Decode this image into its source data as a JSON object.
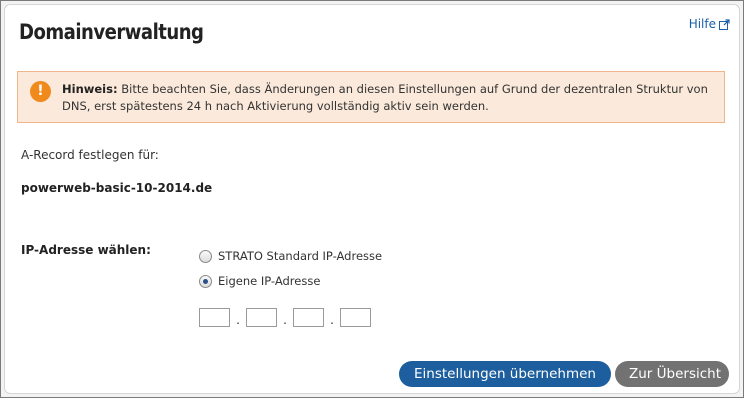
{
  "header": {
    "title": "Domainverwaltung",
    "help_label": "Hilfe"
  },
  "notice": {
    "prefix": "Hinweis:",
    "text": "Bitte beachten Sie, dass Änderungen an diesen Einstellungen auf Grund der dezentralen Struktur von DNS, erst spätestens 24 h nach Aktivierung vollständig aktiv sein werden.",
    "icon_symbol": "!",
    "accent_color": "#f08a1c",
    "background_color": "#fbeadb"
  },
  "record": {
    "label": "A-Record festlegen für:",
    "domain": "powerweb-basic-10-2014.de"
  },
  "ip": {
    "label": "IP-Adresse wählen:",
    "options": [
      {
        "label": "STRATO Standard IP-Adresse",
        "selected": false
      },
      {
        "label": "Eigene IP-Adresse",
        "selected": true
      }
    ],
    "octets": [
      "",
      "",
      "",
      ""
    ],
    "separator": "."
  },
  "buttons": {
    "apply_label": "Einstellungen übernehmen",
    "overview_label": "Zur Übersicht",
    "primary_color": "#1d5e9e",
    "secondary_color": "#727272"
  }
}
